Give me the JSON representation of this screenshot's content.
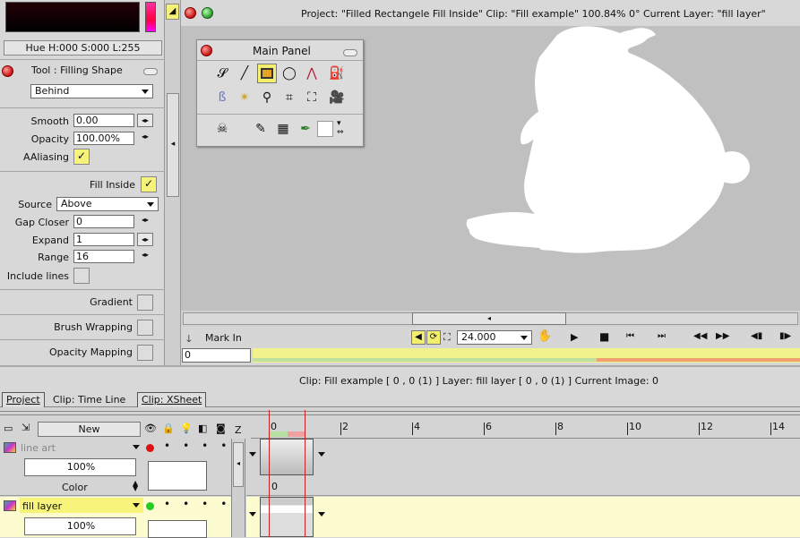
{
  "colors": {
    "accent_yellow": "#f8f47a",
    "selected_row": "#fdfbd0",
    "canvas_bg": "#c0c0c0",
    "timeline_bar": "#f2f28c",
    "timeline_bar_red": "#f0a070",
    "playhead": "#cc2222"
  },
  "color_picker": {
    "hsl_readout": "Hue H:000 S:000 L:255"
  },
  "tool_options": {
    "tool_title": "Tool : Filling Shape",
    "mode_value": "Behind",
    "smooth": {
      "label": "Smooth",
      "value": "0.00"
    },
    "opacity": {
      "label": "Opacity",
      "value": "100.00%"
    },
    "aaliasing": {
      "label": "AAliasing",
      "checked": true
    },
    "fill_inside": {
      "label": "Fill Inside",
      "checked": true
    },
    "source": {
      "label": "Source",
      "value": "Above"
    },
    "gap_closer": {
      "label": "Gap Closer",
      "value": "0"
    },
    "expand": {
      "label": "Expand",
      "value": "1"
    },
    "range": {
      "label": "Range",
      "value": "16"
    },
    "include_lines": {
      "label": "Include lines",
      "checked": false
    },
    "gradient": {
      "label": "Gradient",
      "checked": false
    },
    "brush_wrapping": {
      "label": "Brush Wrapping",
      "checked": false
    },
    "opacity_mapping": {
      "label": "Opacity Mapping",
      "checked": false
    }
  },
  "viewer": {
    "title": "Project:  \"Filled Rectangele Fill Inside\"  Clip: \"Fill example\"   100.84%   0°   Current Layer: \"fill layer\"",
    "main_panel_title": "Main Panel",
    "main_panel_tools_row1": [
      "freehand-icon",
      "line-icon",
      "rectangle-icon",
      "ellipse-icon",
      "bezier-icon",
      "fill-bucket-icon"
    ],
    "main_panel_tools_row2": [
      "brush-fx-icon",
      "sparkle-icon",
      "zoom-icon",
      "crop-icon",
      "transform-icon",
      "camera-icon"
    ],
    "main_panel_tools_row3": [
      "skull-icon",
      "pen-icon",
      "texture-icon",
      "eyedropper-icon"
    ],
    "mark_in_label": "Mark In",
    "fps_value": "24.000",
    "frame_input": "0"
  },
  "timeline": {
    "status": "Clip: Fill example [ 0 , 0  (1) ]       Layer: fill layer [ 0 , 0  (1) ]    Current Image: 0",
    "tabs": [
      "Project",
      "Clip: Time Line",
      "Clip: XSheet"
    ],
    "new_button": "New",
    "z_label": "Z",
    "ruler_ticks": [
      "0",
      "2",
      "4",
      "6",
      "8",
      "10",
      "12",
      "14"
    ],
    "layers": [
      {
        "name": "line art",
        "opacity": "100%",
        "mode": "Color",
        "status": "red",
        "frame_label": "0",
        "selected": false
      },
      {
        "name": "fill layer",
        "opacity": "100%",
        "status": "green",
        "selected": true
      }
    ]
  }
}
